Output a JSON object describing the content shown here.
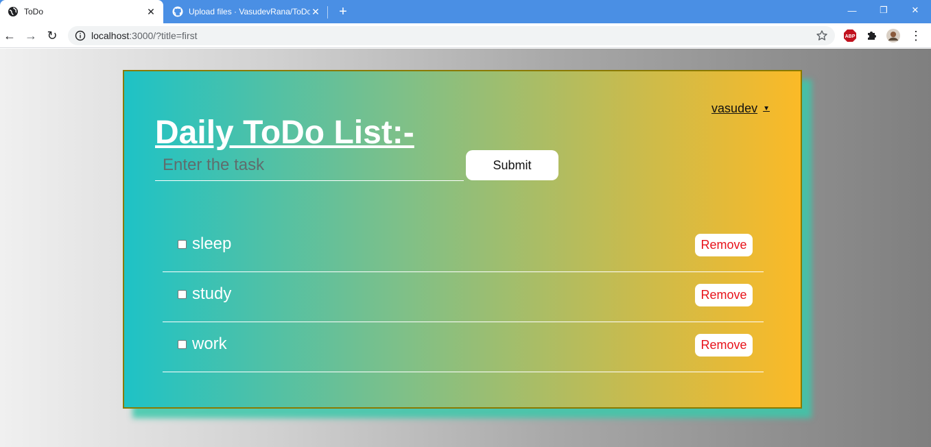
{
  "browser": {
    "tabs": [
      {
        "title": "ToDo",
        "active": true,
        "icon": "globe-icon"
      },
      {
        "title": "Upload files · VasudevRana/ToDo",
        "active": false,
        "icon": "github-icon"
      }
    ],
    "url_host": "localhost",
    "url_rest": ":3000/?title=first"
  },
  "page": {
    "user_menu": "vasudev",
    "heading": "Daily ToDo List:-",
    "input_placeholder": "Enter the task",
    "submit_label": "Submit",
    "remove_label": "Remove",
    "tasks": [
      {
        "name": "sleep",
        "done": false
      },
      {
        "name": "study",
        "done": false
      },
      {
        "name": "work",
        "done": false
      }
    ]
  },
  "colors": {
    "tab_bar": "#4a8fe4",
    "card_start": "#1ec2c6",
    "card_end": "#fbba27",
    "remove_text": "#e8121a"
  }
}
